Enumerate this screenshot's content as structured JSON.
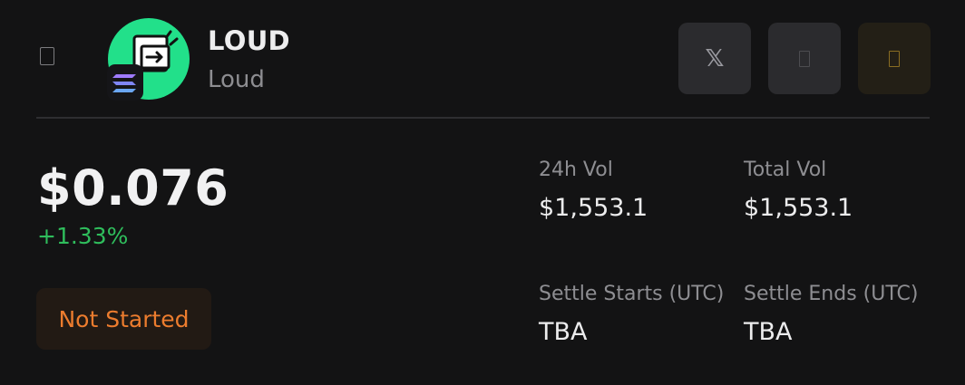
{
  "token": {
    "symbol": "LOUD",
    "name": "Loud"
  },
  "market": {
    "price": "$0.076",
    "change": "+1.33%",
    "status": "Not Started"
  },
  "stats": [
    {
      "label": "24h Vol",
      "value": "$1,553.1"
    },
    {
      "label": "Total Vol",
      "value": "$1,553.1"
    },
    {
      "label": "Settle Starts (UTC)",
      "value": "TBA"
    },
    {
      "label": "Settle Ends (UTC)",
      "value": "TBA"
    }
  ],
  "actions": {
    "x_icon": "𝕏",
    "icons": [
      "x-twitter-icon",
      "website-icon",
      "favorite-icon"
    ]
  },
  "colors": {
    "background": "#131314",
    "logo_green": "#22e08a",
    "positive": "#2fbd5c",
    "status_orange": "#ec7c2e"
  }
}
